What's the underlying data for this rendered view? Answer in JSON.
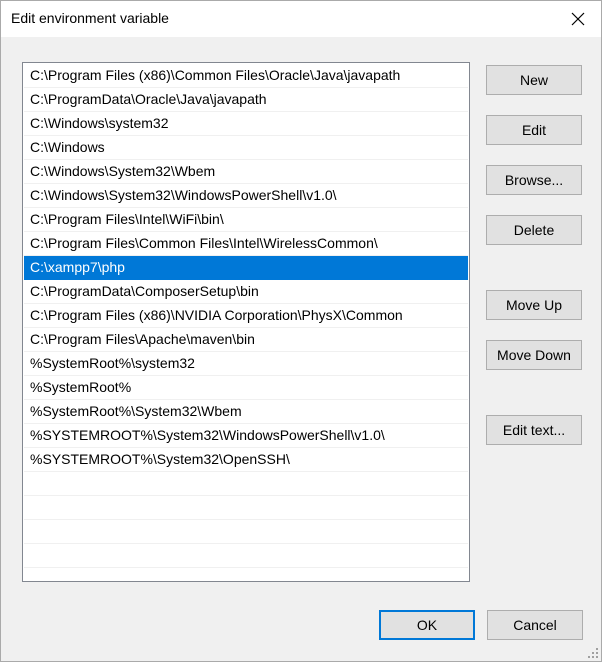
{
  "window": {
    "title": "Edit environment variable"
  },
  "paths": [
    "C:\\Program Files (x86)\\Common Files\\Oracle\\Java\\javapath",
    "C:\\ProgramData\\Oracle\\Java\\javapath",
    "C:\\Windows\\system32",
    "C:\\Windows",
    "C:\\Windows\\System32\\Wbem",
    "C:\\Windows\\System32\\WindowsPowerShell\\v1.0\\",
    "C:\\Program Files\\Intel\\WiFi\\bin\\",
    "C:\\Program Files\\Common Files\\Intel\\WirelessCommon\\",
    "C:\\xampp7\\php",
    "C:\\ProgramData\\ComposerSetup\\bin",
    "C:\\Program Files (x86)\\NVIDIA Corporation\\PhysX\\Common",
    "C:\\Program Files\\Apache\\maven\\bin",
    "%SystemRoot%\\system32",
    "%SystemRoot%",
    "%SystemRoot%\\System32\\Wbem",
    "%SYSTEMROOT%\\System32\\WindowsPowerShell\\v1.0\\",
    "%SYSTEMROOT%\\System32\\OpenSSH\\"
  ],
  "selected_index": 8,
  "buttons": {
    "new": "New",
    "edit": "Edit",
    "browse": "Browse...",
    "delete": "Delete",
    "move_up": "Move Up",
    "move_down": "Move Down",
    "edit_text": "Edit text...",
    "ok": "OK",
    "cancel": "Cancel"
  },
  "colors": {
    "selection": "#0078d7",
    "dialog_bg": "#f0f0f0",
    "button_bg": "#e1e1e1"
  }
}
